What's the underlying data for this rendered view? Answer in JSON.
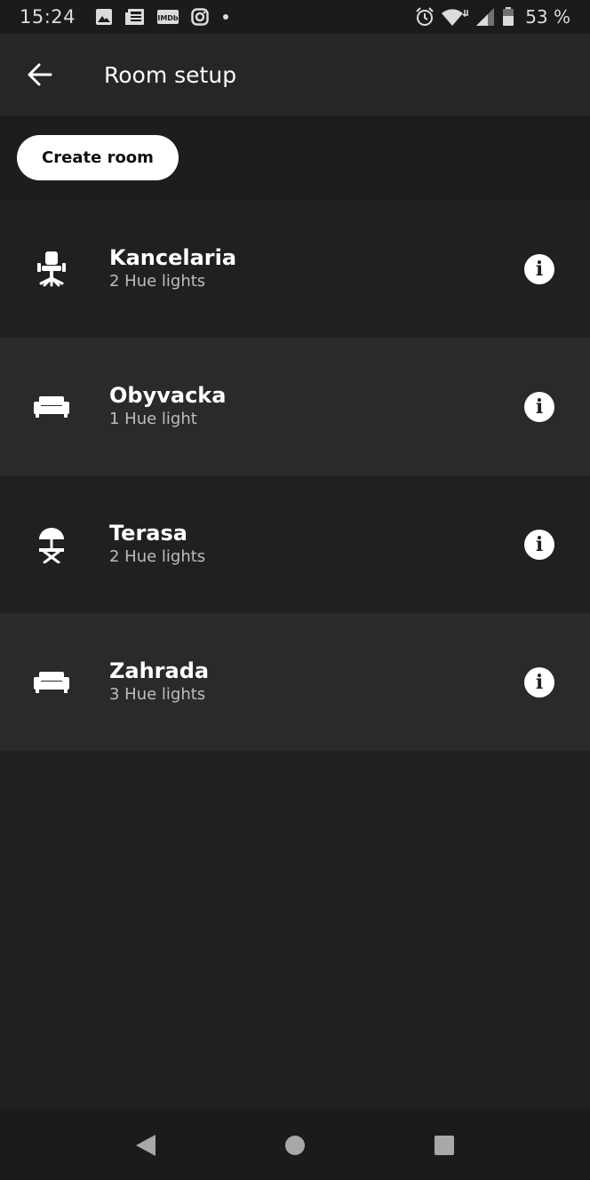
{
  "status_bar": {
    "time": "15:24",
    "battery_percent": "53 %",
    "icons_left": [
      "gallery-icon",
      "news-icon",
      "imdb-icon",
      "instagram-icon",
      "dot-icon"
    ],
    "icons_right": [
      "alarm-icon",
      "wifi-icon",
      "signal-icon",
      "battery-icon"
    ],
    "imdb_text": "IMDb"
  },
  "app_bar": {
    "back_icon": "arrow-left-icon",
    "title": "Room setup"
  },
  "actions": {
    "create_room_label": "Create room"
  },
  "rooms": [
    {
      "name": "Kancelaria",
      "lights": "2 Hue lights",
      "icon": "office-chair-icon"
    },
    {
      "name": "Obyvacka",
      "lights": "1 Hue light",
      "icon": "sofa-icon"
    },
    {
      "name": "Terasa",
      "lights": "2 Hue lights",
      "icon": "parasol-icon"
    },
    {
      "name": "Zahrada",
      "lights": "3 Hue lights",
      "icon": "sofa-icon"
    }
  ],
  "colors": {
    "background": "#202020",
    "row_alt": "#2a2a2a",
    "app_bar": "#262626",
    "button_bg": "#ffffff"
  },
  "nav_bar": {
    "buttons": [
      "back-triangle-icon",
      "home-circle-icon",
      "recents-square-icon"
    ]
  }
}
